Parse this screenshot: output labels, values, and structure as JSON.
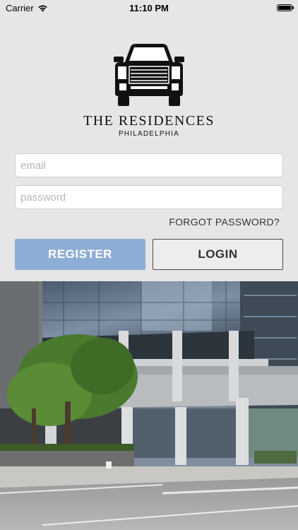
{
  "status_bar": {
    "carrier": "Carrier",
    "time": "11:10 PM"
  },
  "brand": {
    "name": "THE RESIDENCES",
    "city": "PHILADELPHIA"
  },
  "form": {
    "email_placeholder": "email",
    "password_placeholder": "password",
    "forgot_label": "FORGOT PASSWORD?",
    "register_label": "REGISTER",
    "login_label": "LOGIN"
  },
  "colors": {
    "register_bg": "#8eadd6",
    "login_border": "#4a4a4a",
    "background": "#e6e6e6"
  }
}
